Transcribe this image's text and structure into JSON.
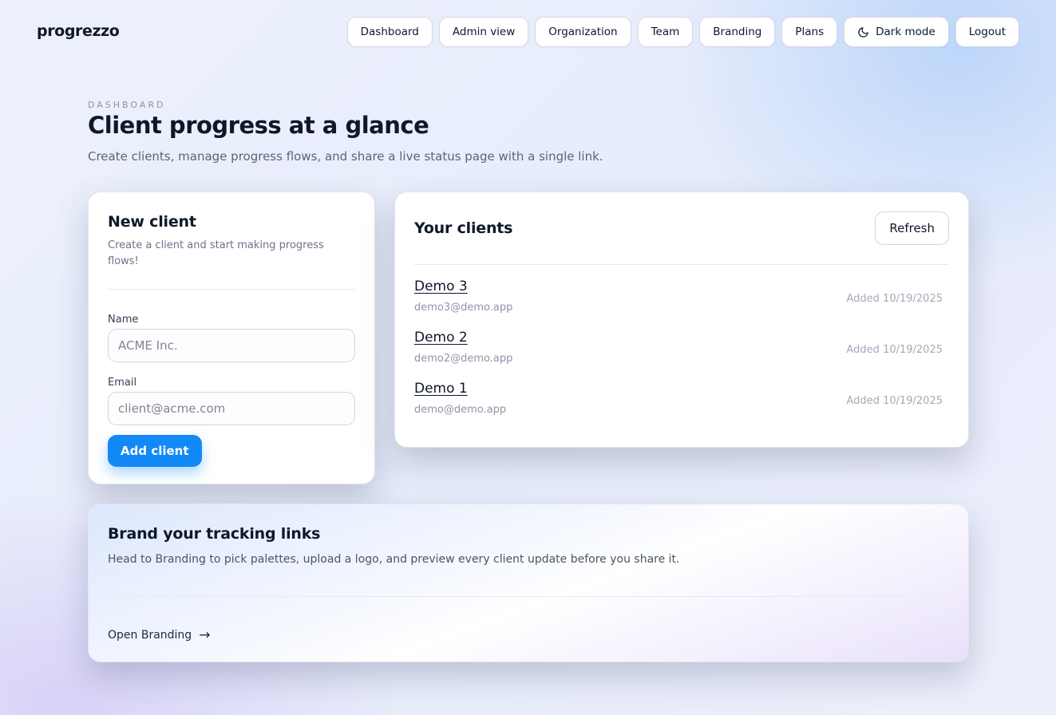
{
  "app": {
    "name": "progrezzo"
  },
  "nav": [
    {
      "label": "Dashboard"
    },
    {
      "label": "Admin view"
    },
    {
      "label": "Organization"
    },
    {
      "label": "Team"
    },
    {
      "label": "Branding"
    },
    {
      "label": "Plans"
    },
    {
      "label": "Dark mode",
      "icon": "moon-icon"
    },
    {
      "label": "Logout"
    }
  ],
  "header": {
    "eyebrow": "DASHBOARD",
    "title": "Client progress at a glance",
    "subtitle": "Create clients, manage progress flows, and share a live status page with a single link."
  },
  "new_client": {
    "title": "New client",
    "description": "Create a client and start making progress flows!",
    "name_label": "Name",
    "name_placeholder": "ACME Inc.",
    "name_value": "",
    "email_label": "Email",
    "email_placeholder": "client@acme.com",
    "email_value": "",
    "submit_label": "Add client",
    "accent_color": "#1289f6"
  },
  "clients": {
    "title": "Your clients",
    "refresh_label": "Refresh",
    "items": [
      {
        "name": "Demo 3",
        "email": "demo3@demo.app",
        "added": "Added 10/19/2025"
      },
      {
        "name": "Demo 2",
        "email": "demo2@demo.app",
        "added": "Added 10/19/2025"
      },
      {
        "name": "Demo 1",
        "email": "demo@demo.app",
        "added": "Added 10/19/2025"
      }
    ]
  },
  "branding_card": {
    "title": "Brand your tracking links",
    "description": "Head to Branding to pick palettes, upload a logo, and preview every client update before you share it.",
    "link_label": "Open Branding",
    "link_icon": "arrow-right-icon"
  }
}
